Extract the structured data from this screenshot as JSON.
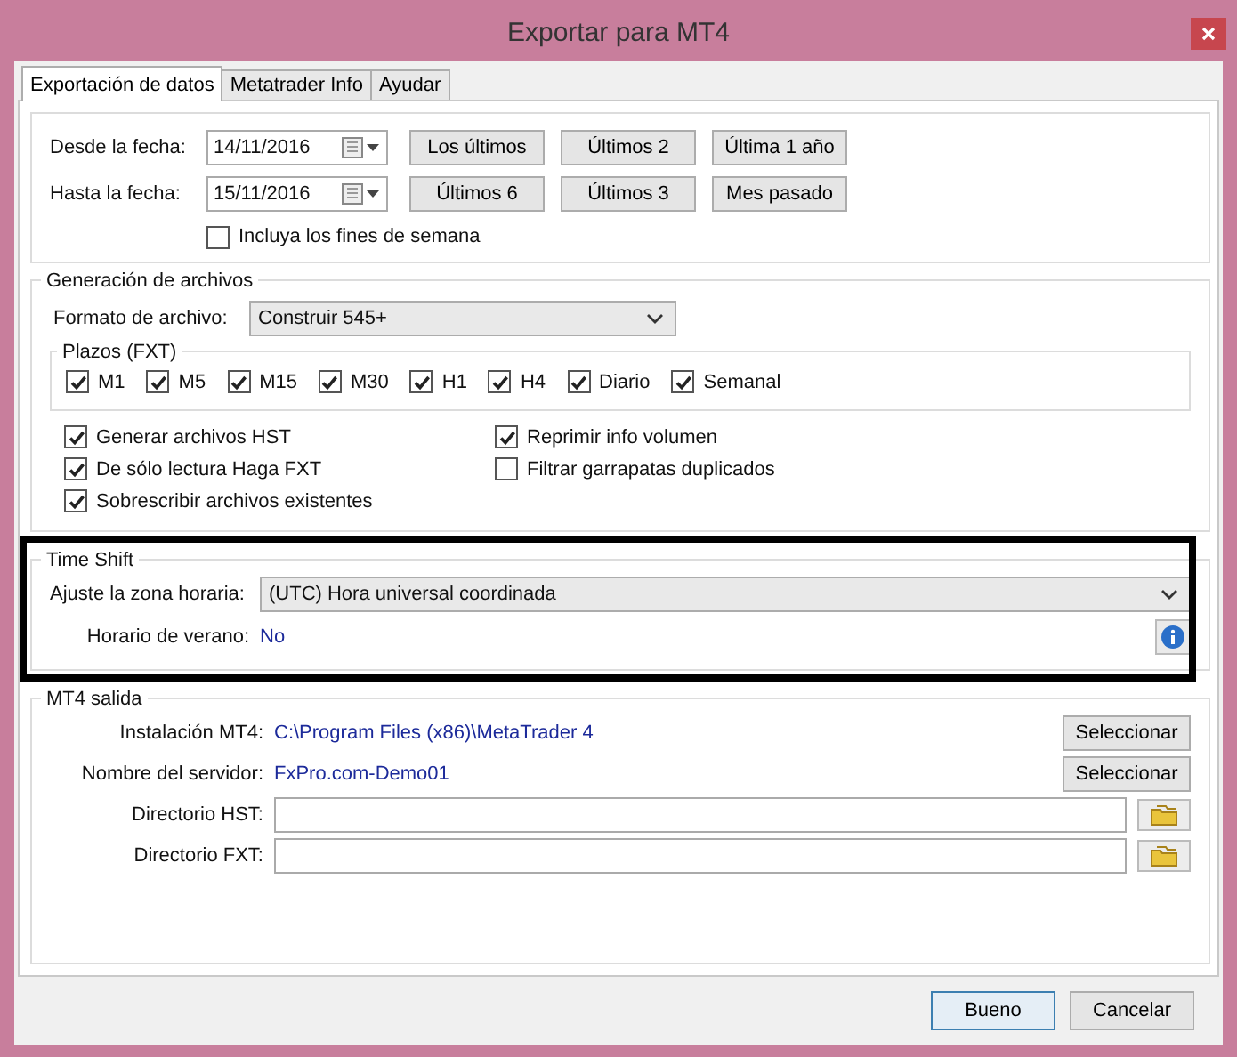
{
  "window": {
    "title": "Exportar para MT4"
  },
  "tabs": [
    {
      "label": "Exportación de datos",
      "selected": true
    },
    {
      "label": "Metatrader Info",
      "selected": false
    },
    {
      "label": "Ayudar",
      "selected": false
    }
  ],
  "date_rows": [
    {
      "label": "Desde la fecha:",
      "value": "14/11/2016",
      "buttons": [
        "Los últimos",
        "Últimos 2",
        "Última 1 año"
      ]
    },
    {
      "label": "Hasta la fecha:",
      "value": "15/11/2016",
      "buttons": [
        "Últimos 6",
        "Últimos 3",
        "Mes pasado"
      ]
    }
  ],
  "include_weekends": {
    "label": "Incluya los fines de semana",
    "checked": false
  },
  "file_generation": {
    "title": "Generación de archivos",
    "format": {
      "label": "Formato de archivo:",
      "value": "Construir 545+"
    },
    "timeframes": {
      "title": "Plazos (FXT)",
      "items": [
        {
          "label": "M1",
          "checked": true
        },
        {
          "label": "M5",
          "checked": true
        },
        {
          "label": "M15",
          "checked": true
        },
        {
          "label": "M30",
          "checked": true
        },
        {
          "label": "H1",
          "checked": true
        },
        {
          "label": "H4",
          "checked": true
        },
        {
          "label": "Diario",
          "checked": true
        },
        {
          "label": "Semanal",
          "checked": true
        }
      ]
    },
    "options_left": [
      {
        "label": "Generar archivos HST",
        "checked": true
      },
      {
        "label": "De sólo lectura Haga FXT",
        "checked": true
      },
      {
        "label": "Sobrescribir archivos existentes",
        "checked": true
      }
    ],
    "options_right": [
      {
        "label": "Reprimir info volumen",
        "checked": true
      },
      {
        "label": "Filtrar garrapatas duplicados",
        "checked": false
      }
    ]
  },
  "time_shift": {
    "title": "Time Shift",
    "timezone": {
      "label": "Ajuste la zona horaria:",
      "value": "(UTC) Hora universal coordinada"
    },
    "dst": {
      "label": "Horario de verano:",
      "value": "No"
    }
  },
  "mt4_output": {
    "title": "MT4 salida",
    "rows": [
      {
        "kind": "text",
        "label": "Instalación MT4:",
        "value": "C:\\Program Files (x86)\\MetaTrader 4",
        "button": "Seleccionar"
      },
      {
        "kind": "text",
        "label": "Nombre del servidor:",
        "value": "FxPro.com-Demo01",
        "button": "Seleccionar"
      },
      {
        "kind": "field",
        "label": "Directorio HST:"
      },
      {
        "kind": "field",
        "label": "Directorio FXT:"
      }
    ]
  },
  "footer_buttons": [
    {
      "label": "Bueno",
      "default": true
    },
    {
      "label": "Cancelar",
      "default": false
    }
  ]
}
